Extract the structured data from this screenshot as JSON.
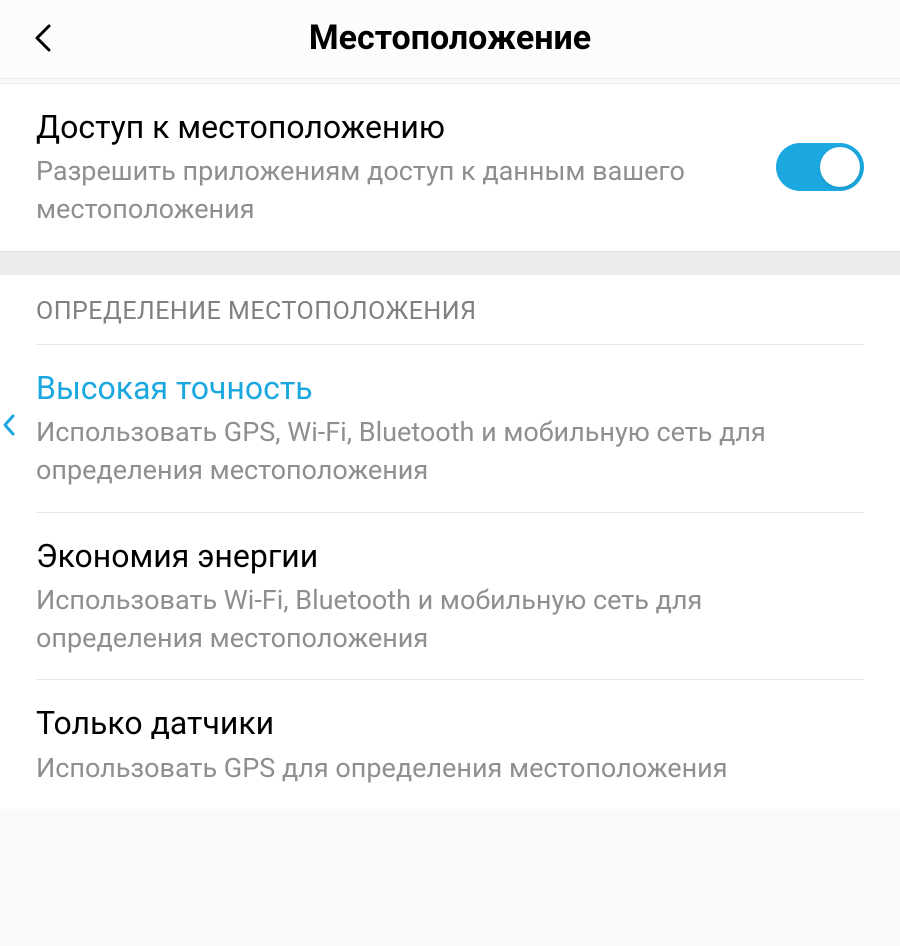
{
  "header": {
    "title": "Местоположение"
  },
  "access": {
    "title": "Доступ к местоположению",
    "subtitle": "Разрешить приложениям доступ к данным вашего местоположения",
    "toggle_on": true
  },
  "section_header": "ОПРЕДЕЛЕНИЕ МЕСТОПОЛОЖЕНИЯ",
  "modes": [
    {
      "title": "Высокая точность",
      "subtitle": "Использовать GPS, Wi-Fi, Bluetooth и мобильную сеть для определения местоположения",
      "selected": true
    },
    {
      "title": "Экономия энергии",
      "subtitle": "Использовать Wi-Fi, Bluetooth и мобильную сеть для определения местоположения",
      "selected": false
    },
    {
      "title": "Только датчики",
      "subtitle": "Использовать GPS для определения местоположения",
      "selected": false
    }
  ]
}
